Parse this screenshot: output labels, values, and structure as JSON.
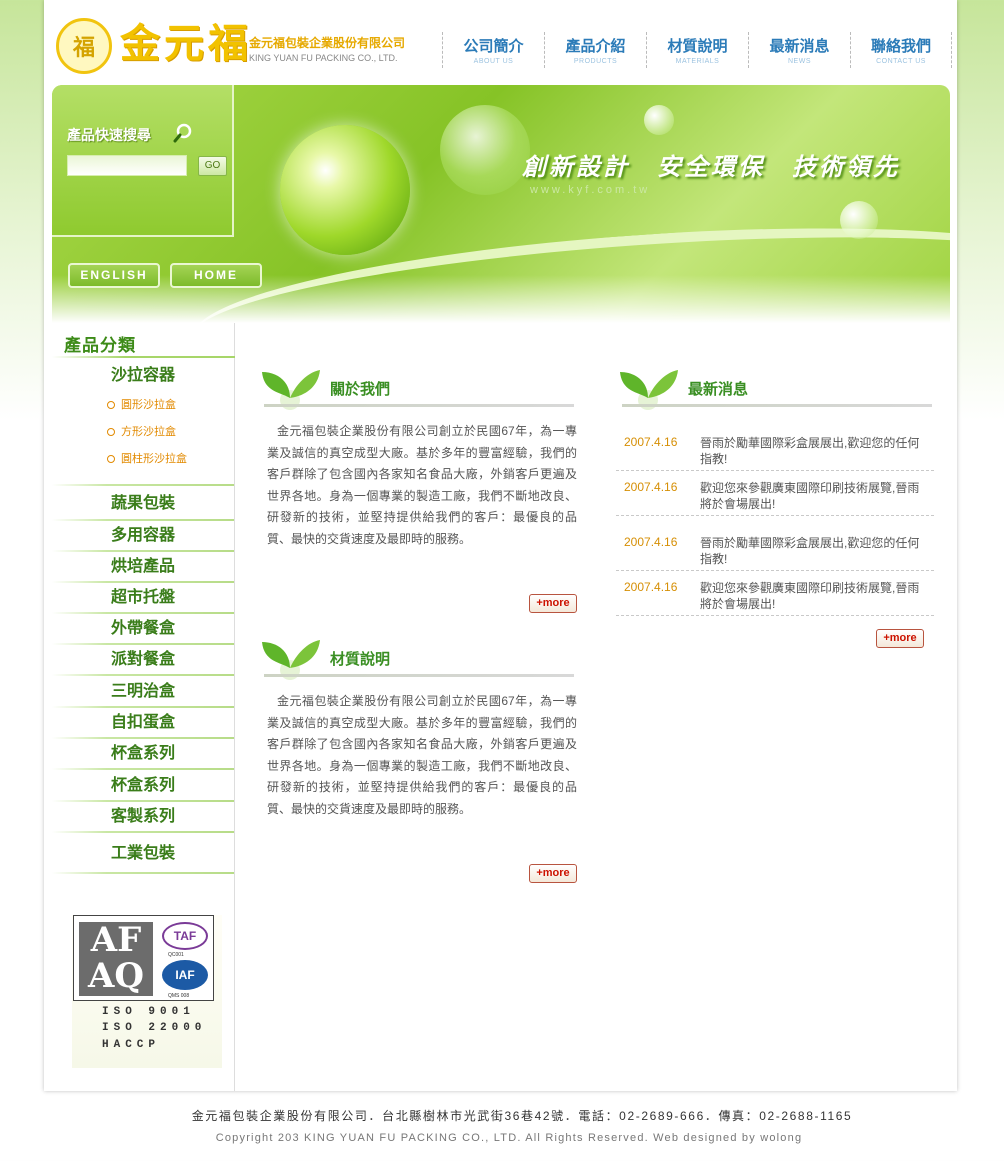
{
  "header": {
    "logo_emblem": "福",
    "logo_main": "金元福",
    "company_cn": "金元福包裝企業股份有限公司",
    "company_en": "KING YUAN FU PACKING CO., LTD.",
    "nav": [
      {
        "label": "公司簡介",
        "sub": "ABOUT US"
      },
      {
        "label": "產品介紹",
        "sub": "PRODUCTS"
      },
      {
        "label": "材質說明",
        "sub": "MATERIALS"
      },
      {
        "label": "最新消息",
        "sub": "NEWS"
      },
      {
        "label": "聯絡我們",
        "sub": "CONTACT US"
      }
    ]
  },
  "banner": {
    "search_title": "產品快速搜尋",
    "search_placeholder": "",
    "go_label": "GO",
    "english_label": "ENGLISH",
    "home_label": "HOME",
    "slogan": "創新設計　安全環保　技術領先",
    "url": "www.kyf.com.tw"
  },
  "sidebar": {
    "title": "產品分類",
    "first_category": "沙拉容器",
    "sub_items": [
      "圓形沙拉盒",
      "方形沙拉盒",
      "圓柱形沙拉盒"
    ],
    "categories": [
      "蔬果包裝",
      "多用容器",
      "烘培產品",
      "超市托盤",
      "外帶餐盒",
      "派對餐盒",
      "三明治盒",
      "自扣蛋盒",
      "杯盒系列",
      "杯盒系列",
      "客製系列",
      "工業包裝"
    ],
    "cert": {
      "afaq": "AF AQ",
      "taf": "TAF",
      "taf_sub": "QC001",
      "iaf": "IAF",
      "iaf_sub": "QMS 008",
      "lines": [
        "ISO 9001",
        "ISO 22000",
        "HACCP"
      ]
    }
  },
  "about": {
    "title": "關於我們",
    "body": "金元福包裝企業股份有限公司創立於民國67年，為一專業及誠信的真空成型大廠。基於多年的豐富經驗，我們的客戶群除了包含國內各家知名食品大廠，外銷客戶更遍及世界各地。身為一個專業的製造工廠，我們不斷地改良、研發新的技術，並堅持提供給我們的客戶：最優良的品質、最快的交貨速度及最即時的服務。",
    "more": "+more"
  },
  "materials": {
    "title": "材質說明",
    "body": "金元福包裝企業股份有限公司創立於民國67年，為一專業及誠信的真空成型大廠。基於多年的豐富經驗，我們的客戶群除了包含國內各家知名食品大廠，外銷客戶更遍及世界各地。身為一個專業的製造工廠，我們不斷地改良、研發新的技術，並堅持提供給我們的客戶：最優良的品質、最快的交貨速度及最即時的服務。",
    "more": "+more"
  },
  "news": {
    "title": "最新消息",
    "items": [
      {
        "date": "2007.4.16",
        "text": "晉雨於勵華國際彩盒展展出,歡迎您的任何指教!"
      },
      {
        "date": "2007.4.16",
        "text": "歡迎您來參觀廣東國際印刷技術展覽,晉雨將於會場展出!"
      },
      {
        "date": "2007.4.16",
        "text": "晉雨於勵華國際彩盒展展出,歡迎您的任何指教!"
      },
      {
        "date": "2007.4.16",
        "text": "歡迎您來參觀廣東國際印刷技術展覽,晉雨將於會場展出!"
      }
    ],
    "more": "+more"
  },
  "footer": {
    "line1": "金元福包裝企業股份有限公司．台北縣樹林市光武街36巷42號．電話：02-2689-666．傳真：02-2688-1165",
    "line2": "Copyright 203 KING YUAN FU  PACKING CO., LTD. All Rights Reserved. Web designed by wolong"
  },
  "colors": {
    "brand_green": "#7dbb2a",
    "title_green": "#3a8f23",
    "nav_blue": "#2b7bb8",
    "logo_gold": "#f2c200",
    "date_orange": "#d68f05",
    "more_red": "#cc1200"
  }
}
